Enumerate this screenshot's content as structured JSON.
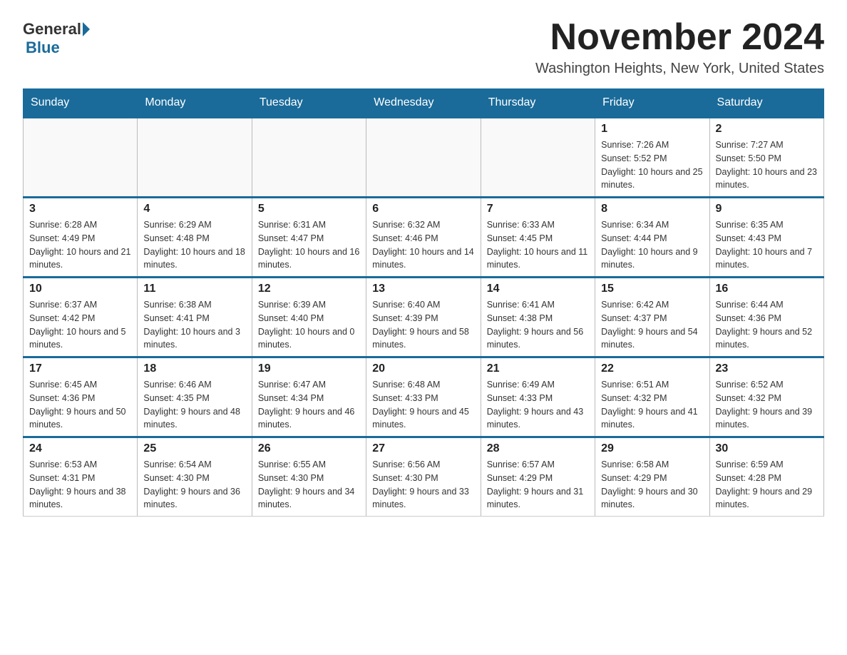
{
  "header": {
    "logo": {
      "part1": "General",
      "part2": "Blue"
    },
    "title": "November 2024",
    "location": "Washington Heights, New York, United States"
  },
  "calendar": {
    "days": [
      "Sunday",
      "Monday",
      "Tuesday",
      "Wednesday",
      "Thursday",
      "Friday",
      "Saturday"
    ],
    "weeks": [
      [
        {
          "day": "",
          "info": ""
        },
        {
          "day": "",
          "info": ""
        },
        {
          "day": "",
          "info": ""
        },
        {
          "day": "",
          "info": ""
        },
        {
          "day": "",
          "info": ""
        },
        {
          "day": "1",
          "info": "Sunrise: 7:26 AM\nSunset: 5:52 PM\nDaylight: 10 hours and 25 minutes."
        },
        {
          "day": "2",
          "info": "Sunrise: 7:27 AM\nSunset: 5:50 PM\nDaylight: 10 hours and 23 minutes."
        }
      ],
      [
        {
          "day": "3",
          "info": "Sunrise: 6:28 AM\nSunset: 4:49 PM\nDaylight: 10 hours and 21 minutes."
        },
        {
          "day": "4",
          "info": "Sunrise: 6:29 AM\nSunset: 4:48 PM\nDaylight: 10 hours and 18 minutes."
        },
        {
          "day": "5",
          "info": "Sunrise: 6:31 AM\nSunset: 4:47 PM\nDaylight: 10 hours and 16 minutes."
        },
        {
          "day": "6",
          "info": "Sunrise: 6:32 AM\nSunset: 4:46 PM\nDaylight: 10 hours and 14 minutes."
        },
        {
          "day": "7",
          "info": "Sunrise: 6:33 AM\nSunset: 4:45 PM\nDaylight: 10 hours and 11 minutes."
        },
        {
          "day": "8",
          "info": "Sunrise: 6:34 AM\nSunset: 4:44 PM\nDaylight: 10 hours and 9 minutes."
        },
        {
          "day": "9",
          "info": "Sunrise: 6:35 AM\nSunset: 4:43 PM\nDaylight: 10 hours and 7 minutes."
        }
      ],
      [
        {
          "day": "10",
          "info": "Sunrise: 6:37 AM\nSunset: 4:42 PM\nDaylight: 10 hours and 5 minutes."
        },
        {
          "day": "11",
          "info": "Sunrise: 6:38 AM\nSunset: 4:41 PM\nDaylight: 10 hours and 3 minutes."
        },
        {
          "day": "12",
          "info": "Sunrise: 6:39 AM\nSunset: 4:40 PM\nDaylight: 10 hours and 0 minutes."
        },
        {
          "day": "13",
          "info": "Sunrise: 6:40 AM\nSunset: 4:39 PM\nDaylight: 9 hours and 58 minutes."
        },
        {
          "day": "14",
          "info": "Sunrise: 6:41 AM\nSunset: 4:38 PM\nDaylight: 9 hours and 56 minutes."
        },
        {
          "day": "15",
          "info": "Sunrise: 6:42 AM\nSunset: 4:37 PM\nDaylight: 9 hours and 54 minutes."
        },
        {
          "day": "16",
          "info": "Sunrise: 6:44 AM\nSunset: 4:36 PM\nDaylight: 9 hours and 52 minutes."
        }
      ],
      [
        {
          "day": "17",
          "info": "Sunrise: 6:45 AM\nSunset: 4:36 PM\nDaylight: 9 hours and 50 minutes."
        },
        {
          "day": "18",
          "info": "Sunrise: 6:46 AM\nSunset: 4:35 PM\nDaylight: 9 hours and 48 minutes."
        },
        {
          "day": "19",
          "info": "Sunrise: 6:47 AM\nSunset: 4:34 PM\nDaylight: 9 hours and 46 minutes."
        },
        {
          "day": "20",
          "info": "Sunrise: 6:48 AM\nSunset: 4:33 PM\nDaylight: 9 hours and 45 minutes."
        },
        {
          "day": "21",
          "info": "Sunrise: 6:49 AM\nSunset: 4:33 PM\nDaylight: 9 hours and 43 minutes."
        },
        {
          "day": "22",
          "info": "Sunrise: 6:51 AM\nSunset: 4:32 PM\nDaylight: 9 hours and 41 minutes."
        },
        {
          "day": "23",
          "info": "Sunrise: 6:52 AM\nSunset: 4:32 PM\nDaylight: 9 hours and 39 minutes."
        }
      ],
      [
        {
          "day": "24",
          "info": "Sunrise: 6:53 AM\nSunset: 4:31 PM\nDaylight: 9 hours and 38 minutes."
        },
        {
          "day": "25",
          "info": "Sunrise: 6:54 AM\nSunset: 4:30 PM\nDaylight: 9 hours and 36 minutes."
        },
        {
          "day": "26",
          "info": "Sunrise: 6:55 AM\nSunset: 4:30 PM\nDaylight: 9 hours and 34 minutes."
        },
        {
          "day": "27",
          "info": "Sunrise: 6:56 AM\nSunset: 4:30 PM\nDaylight: 9 hours and 33 minutes."
        },
        {
          "day": "28",
          "info": "Sunrise: 6:57 AM\nSunset: 4:29 PM\nDaylight: 9 hours and 31 minutes."
        },
        {
          "day": "29",
          "info": "Sunrise: 6:58 AM\nSunset: 4:29 PM\nDaylight: 9 hours and 30 minutes."
        },
        {
          "day": "30",
          "info": "Sunrise: 6:59 AM\nSunset: 4:28 PM\nDaylight: 9 hours and 29 minutes."
        }
      ]
    ]
  }
}
